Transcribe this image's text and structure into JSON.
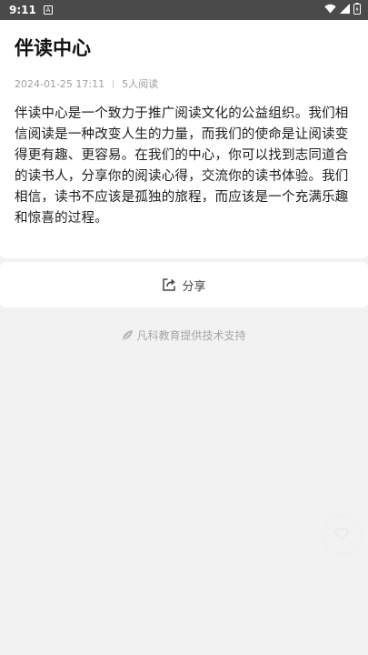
{
  "status_bar": {
    "time": "9:11",
    "notification_icon": "a-notification-icon",
    "wifi_icon": "wifi-icon",
    "signal_icon": "signal-icon",
    "battery_icon": "battery-icon"
  },
  "article": {
    "title": "伴读中心",
    "date": "2024-01-25 17:11",
    "reads": "5人阅读",
    "body": "伴读中心是一个致力于推广阅读文化的公益组织。我们相信阅读是一种改变人生的力量，而我们的使命是让阅读变得更有趣、更容易。在我们的中心，你可以找到志同道合的读书人，分享你的阅读心得，交流你的读书体验。我们相信，读书不应该是孤独的旅程，而应该是一个充满乐趣和惊喜的过程。"
  },
  "share": {
    "label": "分享",
    "icon": "share-icon"
  },
  "footer": {
    "support_text": "凡科教育提供技术支持",
    "icon": "leaf-logo-icon"
  },
  "colors": {
    "status_bar": "#4a4a4a",
    "page_background": "#f2f2f2",
    "card_background": "#ffffff",
    "muted_text": "#a0a0a0"
  }
}
